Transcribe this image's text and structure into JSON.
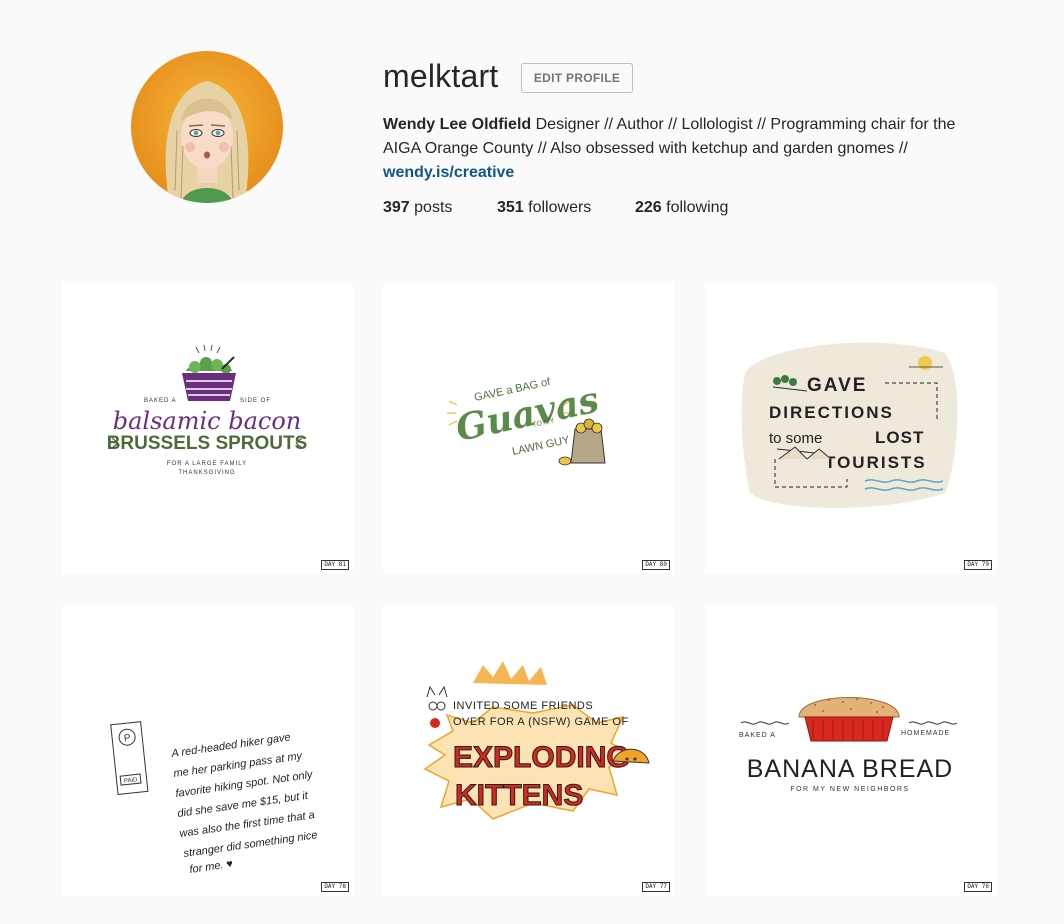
{
  "profile": {
    "username": "melktart",
    "edit_label": "EDIT PROFILE",
    "full_name": "Wendy Lee Oldfield",
    "bio": "Designer // Author // Lollologist // Programming chair for the AIGA Orange County // Also obsessed with ketchup and garden gnomes //",
    "link": "wendy.is/creative",
    "posts_count": "397",
    "posts_label": "posts",
    "followers_count": "351",
    "followers_label": "followers",
    "following_count": "226",
    "following_label": "following"
  },
  "posts": [
    {
      "day": "DAY 81",
      "lines": [
        "BAKED A",
        "SIDE OF",
        "balsamic bacon",
        "BRUSSELS SPROUTS",
        "FOR A LARGE FAMILY",
        "THANKSGIVING"
      ]
    },
    {
      "day": "DAY 80",
      "lines": [
        "GAVE a BAG of",
        "Guavas",
        "TO MY",
        "LAWN GUY"
      ]
    },
    {
      "day": "DAY 79",
      "lines": [
        "GAVE",
        "DIRECTIONS",
        "to some",
        "LOST",
        "TOURISTS"
      ]
    },
    {
      "day": "DAY 78",
      "lines": [
        "A red-headed hiker gave",
        "me her parking pass at my",
        "favorite hiking spot. Not only",
        "did she save me $15, but it",
        "was also the first time that a",
        "stranger did something nice",
        "for me. ♥"
      ],
      "pass": [
        "P",
        "PAID"
      ]
    },
    {
      "day": "DAY 77",
      "lines": [
        "INVITED SOME FRIENDS",
        "OVER FOR A (NSFW) GAME OF",
        "EXPLODING",
        "KITTENS"
      ]
    },
    {
      "day": "DAY 76",
      "lines": [
        "BAKED A",
        "HOMEMADE",
        "BANANA BREAD",
        "FOR MY NEW NEIGHBORS"
      ]
    }
  ],
  "colors": {
    "link": "#125688",
    "text": "#262626",
    "purple": "#6b2d7e",
    "green": "#4d6b3a",
    "red": "#d6281f",
    "orange": "#f2a32a"
  }
}
